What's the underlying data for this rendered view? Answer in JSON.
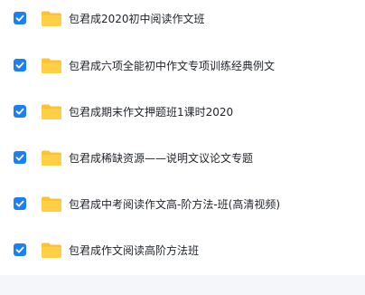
{
  "file_list": {
    "items": [
      {
        "name": "包君成2020初中阅读作文班",
        "checked": true,
        "icon": "folder-icon"
      },
      {
        "name": "包君成六项全能初中作文专项训练经典例文",
        "checked": true,
        "icon": "folder-icon"
      },
      {
        "name": "包君成期末作文押题班1课时2020",
        "checked": true,
        "icon": "folder-icon"
      },
      {
        "name": "包君成稀缺资源——说明文议论文专题",
        "checked": true,
        "icon": "folder-icon"
      },
      {
        "name": "包君成中考阅读作文高-阶方法-班(高清视频)",
        "checked": true,
        "icon": "folder-icon"
      },
      {
        "name": "包君成作文阅读高阶方法班",
        "checked": true,
        "icon": "folder-icon"
      }
    ]
  },
  "colors": {
    "checkbox": "#1c7ff6",
    "folder": "#fdc22f",
    "text": "#1f2329"
  }
}
